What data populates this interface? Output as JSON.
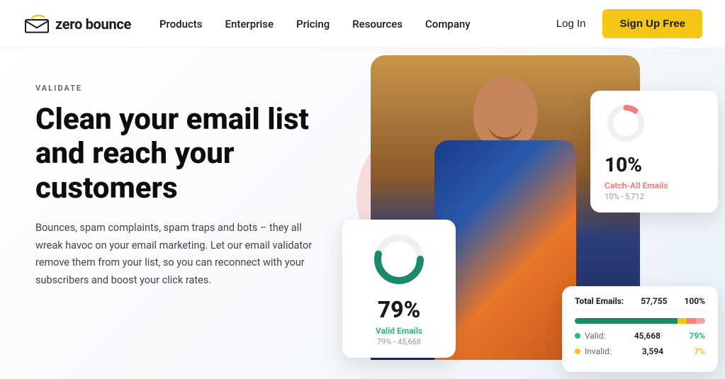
{
  "navbar": {
    "logo_text": "zero bounce",
    "nav_items": [
      {
        "label": "Products",
        "id": "products"
      },
      {
        "label": "Enterprise",
        "id": "enterprise"
      },
      {
        "label": "Pricing",
        "id": "pricing"
      },
      {
        "label": "Resources",
        "id": "resources"
      },
      {
        "label": "Company",
        "id": "company"
      }
    ],
    "login_label": "Log In",
    "signup_label": "Sign Up Free"
  },
  "hero": {
    "validate_label": "VALIDATE",
    "heading": "Clean your email list and reach your customers",
    "description": "Bounces, spam complaints, spam traps and bots – they all wreak havoc on your email marketing. Let our email validator remove them from your list, so you can reconnect with your subscribers and boost your click rates."
  },
  "stats": {
    "top_card": {
      "percent": "10%",
      "label": "Catch-All Emails",
      "sub": "10% - 5,712"
    },
    "bottom_left": {
      "percent": "79%",
      "label": "Valid Emails",
      "sub": "79% - 45,668"
    },
    "bottom_right": {
      "title": "Total Emails:",
      "total_val": "57,755",
      "total_pct": "100%",
      "rows": [
        {
          "dot": "green",
          "label": "Valid:",
          "val": "45,668",
          "pct": "79%",
          "pct_class": "pct-green"
        },
        {
          "dot": "yellow",
          "label": "Invalid:",
          "val": "3,594",
          "pct": "7%",
          "pct_class": "pct-yellow"
        }
      ]
    }
  }
}
